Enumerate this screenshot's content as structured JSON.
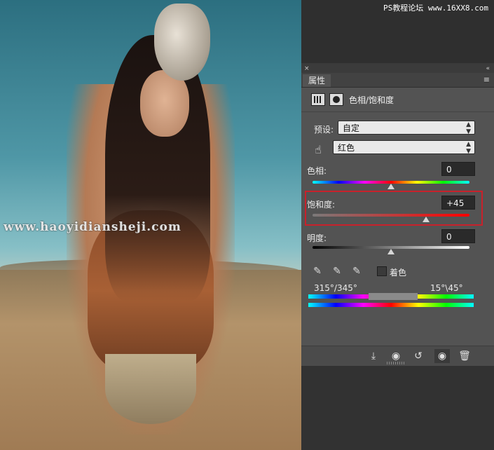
{
  "watermarks": {
    "top_right": "PS教程论坛 www.16XX8.com",
    "left": "www.haoyidiansheji.com"
  },
  "panel": {
    "tab_label": "属性",
    "menu_icon": "≡",
    "collapse_icon": "«",
    "close_icon": "×",
    "title": "色相/饱和度",
    "preset_label": "预设:",
    "preset_value": "自定",
    "channel_value": "红色",
    "hue": {
      "label": "色相:",
      "value": "0",
      "level": 0.5
    },
    "saturation": {
      "label": "饱和度:",
      "value": "+45",
      "level": 0.725
    },
    "lightness": {
      "label": "明度:",
      "value": "0",
      "level": 0.5
    },
    "colorize_label": "着色",
    "range_left": "315°/345°",
    "range_right": "15°\\45°",
    "highlight_color": "#c8212b"
  },
  "bottom_icons": [
    "clip-to-layer-icon",
    "view-previous-icon",
    "reset-icon",
    "visibility-eye-icon",
    "trash-icon"
  ]
}
